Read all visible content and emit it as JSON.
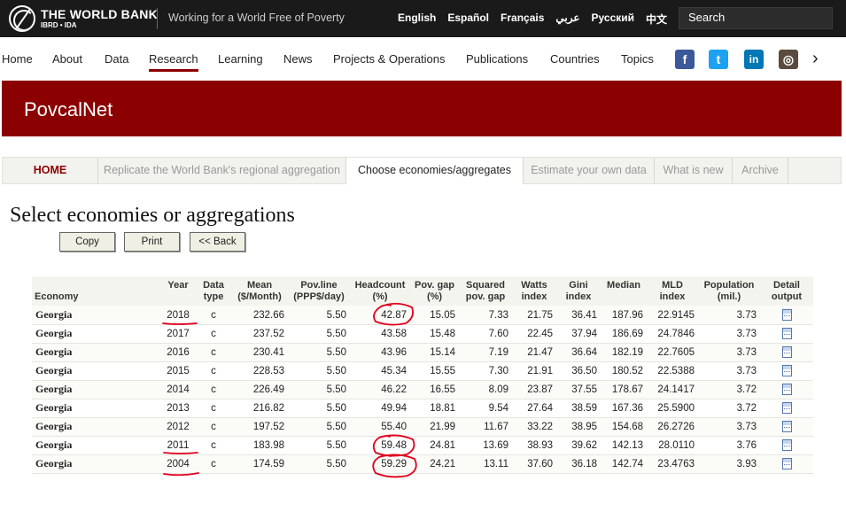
{
  "header": {
    "brand_name": "THE WORLD BANK",
    "brand_sub": "IBRD • IDA",
    "tagline": "Working for a World Free of Poverty",
    "languages": [
      "English",
      "Español",
      "Français",
      "عربي",
      "Русский",
      "中文"
    ],
    "search_label": "Search"
  },
  "nav": {
    "items": [
      "Home",
      "About",
      "Data",
      "Research",
      "Learning",
      "News",
      "Projects & Operations",
      "Publications",
      "Countries",
      "Topics"
    ],
    "active": "Research",
    "social": [
      {
        "icon": "facebook-icon",
        "glyph": "f",
        "color": "#3b5998"
      },
      {
        "icon": "twitter-icon",
        "glyph": "t",
        "color": "#1da1f2"
      },
      {
        "icon": "linkedin-icon",
        "glyph": "in",
        "color": "#0077b5"
      },
      {
        "icon": "instagram-icon",
        "glyph": "◎",
        "color": "#5b4a3f"
      }
    ]
  },
  "banner": {
    "title": "PovcalNet",
    "color": "#8b0000"
  },
  "tabs": [
    "HOME",
    "Replicate the World Bank's regional aggregation",
    "Choose economies/aggregates",
    "Estimate your own data",
    "What is new",
    "Archive"
  ],
  "selected_tab": "Choose economies/aggregates",
  "page": {
    "heading": "Select economies or aggregations",
    "buttons": {
      "copy": "Copy",
      "print": "Print",
      "back": "<< Back"
    }
  },
  "table": {
    "headers": {
      "economy": "Economy",
      "year": "Year",
      "data_type": [
        "Data",
        "type"
      ],
      "mean": [
        "Mean",
        "($/Month)"
      ],
      "povline": [
        "Pov.line",
        "(PPP$/day)"
      ],
      "headcount": [
        "Headcount",
        "(%)"
      ],
      "povgap": [
        "Pov. gap",
        "(%)"
      ],
      "sqgap": [
        "Squared",
        "pov. gap"
      ],
      "watts": [
        "Watts",
        "index"
      ],
      "gini": [
        "Gini",
        "index"
      ],
      "median": "Median",
      "mld": [
        "MLD",
        "index"
      ],
      "population": [
        "Population",
        "(mil.)"
      ],
      "detail": [
        "Detail",
        "output"
      ]
    },
    "rows": [
      [
        "Georgia",
        "2018",
        "c",
        "232.66",
        "5.50",
        "42.87",
        "15.05",
        "7.33",
        "21.75",
        "36.41",
        "187.96",
        "22.9145",
        "3.73"
      ],
      [
        "Georgia",
        "2017",
        "c",
        "237.52",
        "5.50",
        "43.58",
        "15.48",
        "7.60",
        "22.45",
        "37.94",
        "186.69",
        "24.7846",
        "3.73"
      ],
      [
        "Georgia",
        "2016",
        "c",
        "230.41",
        "5.50",
        "43.96",
        "15.14",
        "7.19",
        "21.47",
        "36.64",
        "182.19",
        "22.7605",
        "3.73"
      ],
      [
        "Georgia",
        "2015",
        "c",
        "228.53",
        "5.50",
        "45.34",
        "15.55",
        "7.30",
        "21.91",
        "36.50",
        "180.52",
        "22.5388",
        "3.73"
      ],
      [
        "Georgia",
        "2014",
        "c",
        "226.49",
        "5.50",
        "46.22",
        "16.55",
        "8.09",
        "23.87",
        "37.55",
        "178.67",
        "24.1417",
        "3.72"
      ],
      [
        "Georgia",
        "2013",
        "c",
        "216.82",
        "5.50",
        "49.94",
        "18.81",
        "9.54",
        "27.64",
        "38.59",
        "167.36",
        "25.5900",
        "3.72"
      ],
      [
        "Georgia",
        "2012",
        "c",
        "197.52",
        "5.50",
        "55.40",
        "21.99",
        "11.67",
        "33.22",
        "38.95",
        "154.68",
        "26.2726",
        "3.73"
      ],
      [
        "Georgia",
        "2011",
        "c",
        "183.98",
        "5.50",
        "59.48",
        "24.81",
        "13.69",
        "38.93",
        "39.62",
        "142.13",
        "28.0110",
        "3.76"
      ],
      [
        "Georgia",
        "2004",
        "c",
        "174.59",
        "5.50",
        "59.29",
        "24.21",
        "13.11",
        "37.60",
        "36.18",
        "142.74",
        "23.4763",
        "3.93"
      ]
    ],
    "detail_icon": "calculator-icon"
  },
  "annotations": {
    "color": "#e0001b"
  }
}
